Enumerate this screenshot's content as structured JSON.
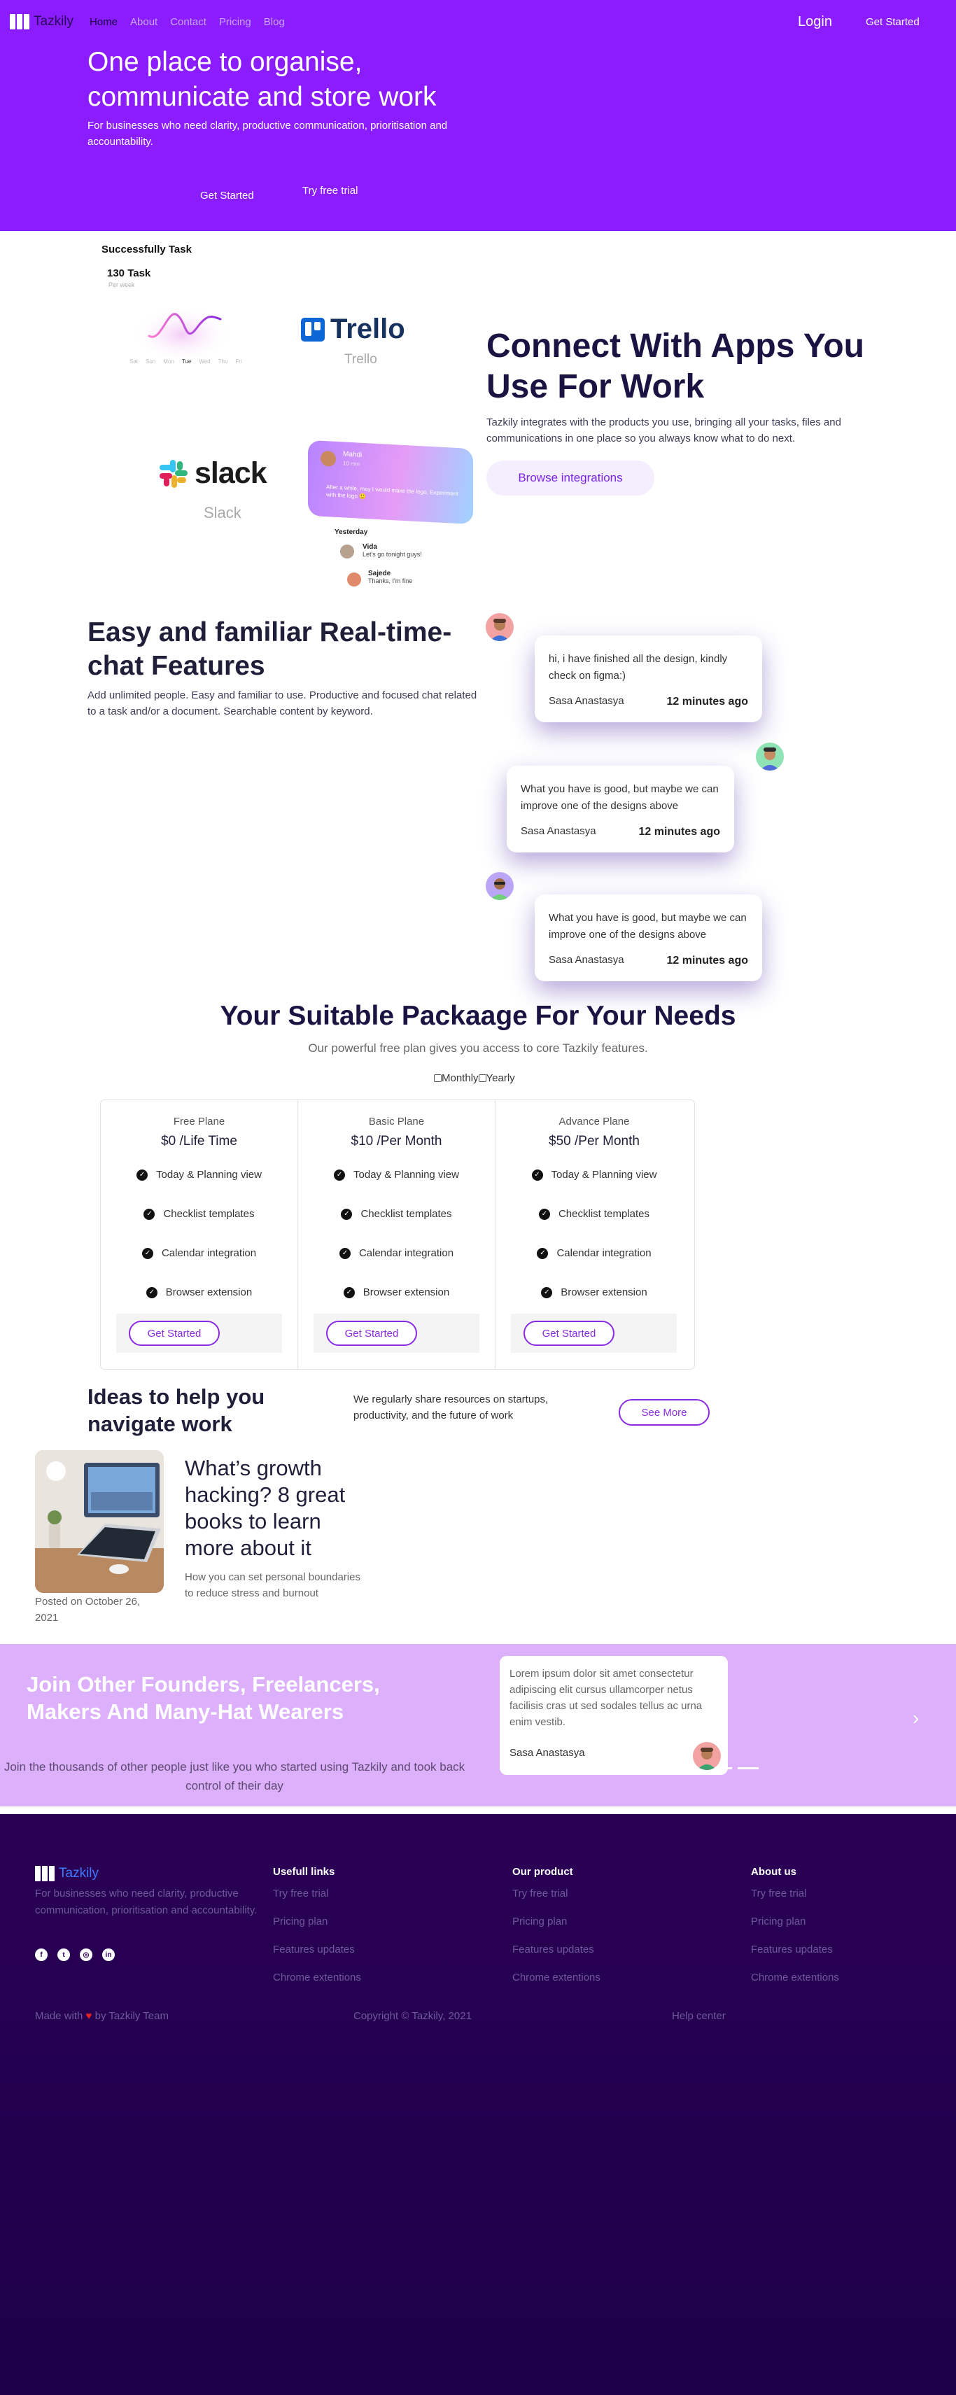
{
  "nav": {
    "brand": "Tazkily",
    "links": [
      "Home",
      "About",
      "Contact",
      "Pricing",
      "Blog"
    ],
    "login": "Login",
    "get_started": "Get Started"
  },
  "hero": {
    "title": "One place to organise, communicate and store work",
    "subtitle": "For businesses who need clarity, productive communication, prioritisation and accountability.",
    "cta_primary": "Get Started",
    "cta_secondary": "Try free trial",
    "bg_color": "#8b1cfd"
  },
  "integrations": {
    "task_widget": {
      "title": "Successfully Task",
      "count": "130 Task",
      "period": "Per week",
      "days": [
        "Sat",
        "Sun",
        "Mon",
        "Tue",
        "Wed",
        "Thu",
        "Fri"
      ]
    },
    "trello": {
      "logo": "Trello",
      "caption": "Trello"
    },
    "slack": {
      "logo": "slack",
      "caption": "Slack"
    },
    "chat_card": {
      "name": "Mahdi",
      "time": "10 min",
      "message": "After a while, may I would make the logo, Experiment with the logo 🙂"
    },
    "yesterday_label": "Yesterday",
    "mini_messages": [
      {
        "name": "Vida",
        "text": "Let's go tonight guys!"
      },
      {
        "name": "Sajede",
        "text": "Thanks, I'm fine"
      }
    ],
    "heading": "Connect With Apps You Use For Work",
    "text": "Tazkily integrates with the products you use, bringing all your tasks, files and communications in one place so you always know what to do next.",
    "button": "Browse integrations"
  },
  "realtime": {
    "heading": "Easy and familiar Real-time-chat Features",
    "text": "Add unlimited people. Easy and familiar to use. Productive and focused chat related to a task and/or a document. Searchable content by keyword.",
    "messages": [
      {
        "text": "hi, i have finished all the design, kindly check on figma:)",
        "author": "Sasa Anastasya",
        "time": "12 minutes ago"
      },
      {
        "text": "What you have is good, but maybe we can improve one of the designs above",
        "author": "Sasa Anastasya",
        "time": "12 minutes ago"
      },
      {
        "text": "What you have is good, but maybe we can improve one of the designs above",
        "author": "Sasa Anastasya",
        "time": "12 minutes ago"
      }
    ]
  },
  "pricing": {
    "heading": "Your Suitable Packaage For Your Needs",
    "subtitle": "Our powerful free plan gives you access to core Tazkily features.",
    "toggle": {
      "monthly": "Monthly",
      "yearly": "Yearly"
    },
    "plans": [
      {
        "name": "Free Plane",
        "price": "$0 /Life Time",
        "features": [
          "Today & Planning view",
          "Checklist templates",
          "Calendar integration",
          "Browser extension"
        ],
        "cta": "Get Started"
      },
      {
        "name": "Basic Plane",
        "price": "$10 /Per Month",
        "features": [
          "Today & Planning view",
          "Checklist templates",
          "Calendar integration",
          "Browser extension"
        ],
        "cta": "Get Started"
      },
      {
        "name": "Advance Plane",
        "price": "$50 /Per Month",
        "features": [
          "Today & Planning view",
          "Checklist templates",
          "Calendar integration",
          "Browser extension"
        ],
        "cta": "Get Started"
      }
    ]
  },
  "blog": {
    "heading": "Ideas to help you navigate work",
    "text": "We regularly share resources on startups, productivity, and the future of work",
    "see_more": "See More",
    "post": {
      "date": "Posted on October 26, 2021",
      "title": "What’s growth hacking? 8 great books to learn more about it",
      "excerpt": "How you can set personal boundaries to reduce stress and burnout"
    }
  },
  "founders": {
    "heading": "Join Other Founders, Freelancers, Makers And Many-Hat Wearers",
    "text": "Join the thousands of other people just like you who started using Tazkily and took back control of their day",
    "testimonial": {
      "text": "Lorem ipsum dolor sit amet consectetur adipiscing elit cursus ullamcorper netus facilisis cras ut sed sodales tellus ac urna enim vestib.",
      "author": "Sasa Anastasya"
    },
    "bg_color": "#dcb0fb"
  },
  "footer": {
    "brand": "Tazkily",
    "description": "For businesses who need clarity, productive communication, prioritisation and accountability.",
    "social": [
      "facebook-icon",
      "twitter-icon",
      "instagram-icon",
      "linkedin-icon"
    ],
    "columns": [
      {
        "title": "Usefull links",
        "links": [
          "Try free trial",
          "Pricing plan",
          "Features updates",
          "Chrome extentions"
        ]
      },
      {
        "title": "Our product",
        "links": [
          "Try free trial",
          "Pricing plan",
          "Features updates",
          "Chrome extentions"
        ]
      },
      {
        "title": "About us",
        "links": [
          "Try free trial",
          "Pricing plan",
          "Features updates",
          "Chrome extentions"
        ]
      }
    ],
    "made_with_prefix": "Made with",
    "made_with_suffix": "by Tazkily Team",
    "copyright": "Copyright © Tazkily, 2021",
    "help": "Help center"
  }
}
